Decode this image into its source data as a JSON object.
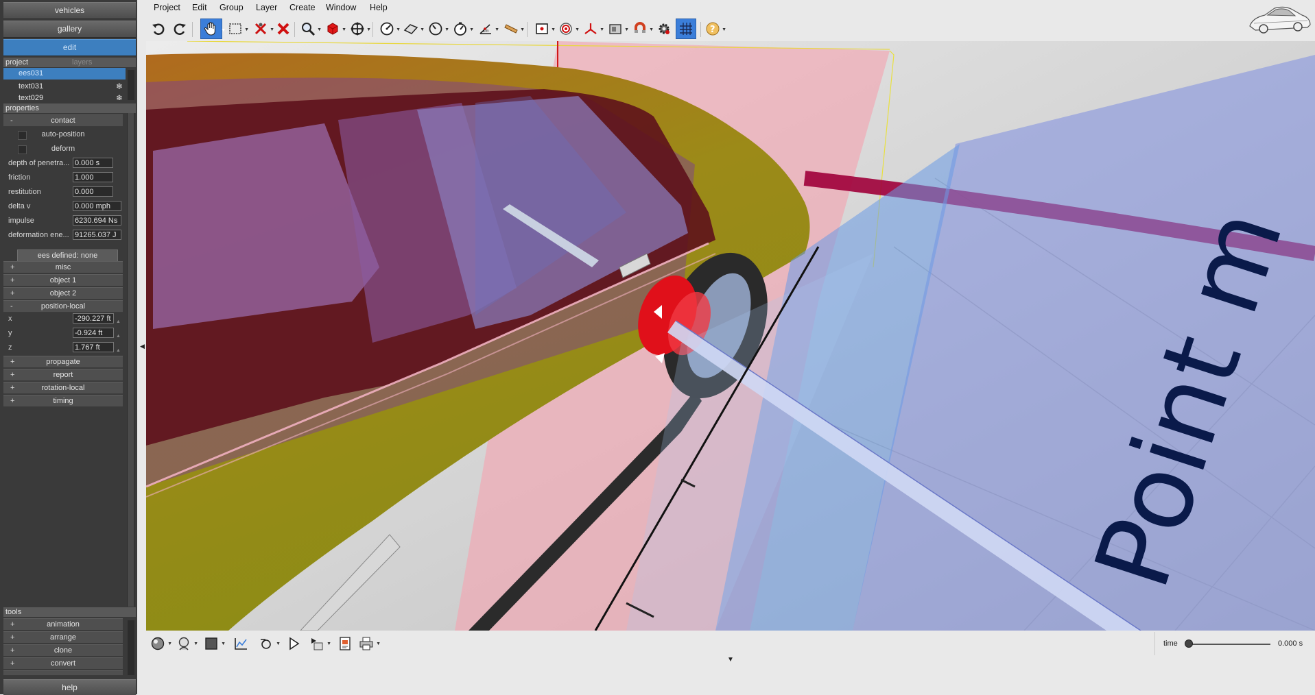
{
  "nav": {
    "vehicles": "vehicles",
    "gallery": "gallery",
    "edit": "edit"
  },
  "project": {
    "tab_project": "project",
    "tab_layers": "layers",
    "items": [
      "ees031",
      "text031",
      "text029"
    ]
  },
  "properties": {
    "header": "properties",
    "contact": {
      "title": "contact",
      "auto_position": "auto-position",
      "deform": "deform",
      "fields": [
        {
          "label": "depth of penetra...",
          "value": "0.000 s"
        },
        {
          "label": "friction",
          "value": "1.000"
        },
        {
          "label": "restitution",
          "value": "0.000"
        },
        {
          "label": "delta v",
          "value": "0.000 mph"
        },
        {
          "label": "impulse",
          "value": "6230.694 Ns"
        },
        {
          "label": "deformation ene...",
          "value": "91265.037 J"
        }
      ],
      "ees_button": "ees defined: none"
    },
    "groups_a": [
      "misc",
      "object 1",
      "object 2"
    ],
    "position_local": {
      "title": "position-local",
      "fields": [
        {
          "label": "x",
          "value": "-290.227 ft"
        },
        {
          "label": "y",
          "value": "-0.924 ft"
        },
        {
          "label": "z",
          "value": "1.767 ft"
        }
      ]
    },
    "groups_b": [
      "propagate",
      "report",
      "rotation-local",
      "timing"
    ]
  },
  "tools": {
    "header": "tools",
    "items": [
      "animation",
      "arrange",
      "clone",
      "convert"
    ]
  },
  "help": "help",
  "menu": [
    "Project",
    "Edit",
    "Group",
    "Layer",
    "Create",
    "Window",
    "Help"
  ],
  "viewport": {
    "scene_text": "Point m"
  },
  "time": {
    "label": "time",
    "value": "0.000 s",
    "position": 0
  },
  "colors": {
    "accent": "#3d7fbf",
    "panel": "#3a3a3a",
    "car_body": "#a0a21a",
    "contact_disc": "#e0101a",
    "plane_pink": "#e8a8b0",
    "plane_blue": "#8ea8e8"
  }
}
